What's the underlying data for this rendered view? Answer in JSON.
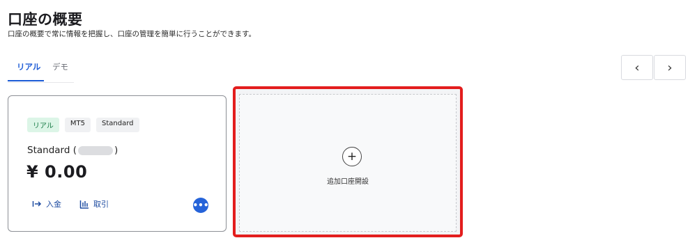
{
  "header": {
    "title": "口座の概要",
    "subtitle": "口座の概要で常に情報を把握し、口座の管理を簡単に行うことができます。"
  },
  "tabs": [
    {
      "label": "リアル",
      "active": true
    },
    {
      "label": "デモ",
      "active": false
    }
  ],
  "pager": {
    "prev": "‹",
    "next": "›"
  },
  "account_card": {
    "badges": [
      "リアル",
      "MT5",
      "Standard"
    ],
    "name": "Standard (",
    "name_close": ")",
    "balance": "¥ 0.00",
    "deposit_label": "入金",
    "trade_label": "取引",
    "more_label": "•••"
  },
  "add_account": {
    "plus": "+",
    "label": "追加口座開設"
  },
  "colors": {
    "accent": "#1c5bd6",
    "highlight": "#e31d1d",
    "badge_real_bg": "#dcf5e7"
  }
}
